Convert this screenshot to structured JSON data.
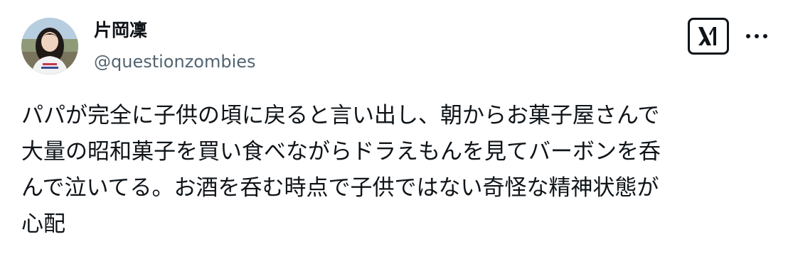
{
  "author": {
    "display_name": "片岡凜",
    "handle": "@questionzombies"
  },
  "icons": {
    "logo": "x-logo-icon",
    "more": "more-dots-icon"
  },
  "post": {
    "text": "パパが完全に子供の頃に戻ると言い出し、朝からお菓子屋さんで\n大量の昭和菓子を買い食べながらドラえもんを見てバーボンを呑\nんで泣いてる。お酒を呑む時点で子供ではない奇怪な精神状態が\n心配"
  },
  "colors": {
    "text_primary": "#0f1419",
    "text_secondary": "#536471",
    "background": "#ffffff"
  }
}
